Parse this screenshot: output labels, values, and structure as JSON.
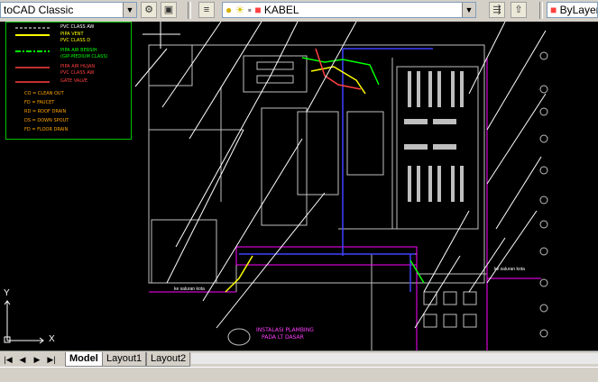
{
  "toolbar": {
    "workspace": "toCAD Classic",
    "layer": "KABEL",
    "linetype": "ByLayer"
  },
  "legend": {
    "items": [
      {
        "label": "PVC CLASS AW",
        "color": "#ffffff"
      },
      {
        "label": "PIPA VENT",
        "color": "#ffff00"
      },
      {
        "label": "PVC CLASS D",
        "color": "#ffff00"
      },
      {
        "label": "PIPA AIR BERSIH",
        "color": "#00ff00"
      },
      {
        "label": "(GIP-MEDIUM CLASS)",
        "color": "#00ff00"
      },
      {
        "label": "PIPA AIR HUJAN",
        "color": "#ff4040"
      },
      {
        "label": "PVC CLASS AW",
        "color": "#ff4040"
      },
      {
        "label": "GATE VALVE",
        "color": "#ff4040"
      },
      {
        "label": "CO = CLEAN OUT",
        "color": "#ffa500"
      },
      {
        "label": "FD = FAUCET",
        "color": "#ffa500"
      },
      {
        "label": "RD = ROOF DRAIN",
        "color": "#ffa500"
      },
      {
        "label": "DS = DOWN SPOUT",
        "color": "#ffa500"
      },
      {
        "label": "FD = FLOOR DRAIN",
        "color": "#ffa500"
      }
    ]
  },
  "drawing": {
    "title": "INSTALASI PLAMBING",
    "subtitle": "PADA LT DASAR",
    "note_left": "ke saluran kota",
    "note_right": "ke saluran kota"
  },
  "ucs": {
    "x_label": "X",
    "y_label": "Y"
  },
  "tabs": [
    {
      "label": "Model",
      "active": true
    },
    {
      "label": "Layout1",
      "active": false
    },
    {
      "label": "Layout2",
      "active": false
    }
  ],
  "colors": {
    "background": "#000000",
    "grid_white": "#ffffff",
    "legend_frame": "#00c000",
    "magenta": "#ff00ff",
    "blue": "#4040ff"
  }
}
